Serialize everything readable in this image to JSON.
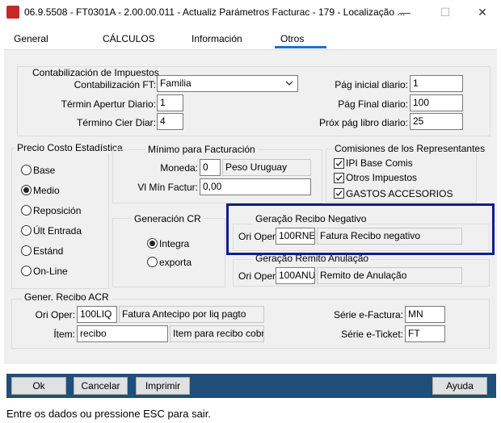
{
  "window": {
    "title": "06.9.5508 - FT0301A - 2.00.00.011 - Actualiz Parámetros Facturac - 179 - Localização ...",
    "min": "—",
    "max": "☐",
    "close": "✕"
  },
  "tabs": [
    "General",
    "CÁLCULOS",
    "Información",
    "Otros"
  ],
  "contab": {
    "title": "Contabilización de Impuestos",
    "ft_label": "Contabilización FT:",
    "ft_value": "Familia",
    "apertura_label": "Términ Apertur Diario:",
    "apertura_value": "1",
    "cierre_label": "Término Cier Diar:",
    "cierre_value": "4",
    "pag_inicial_label": "Pág inicial diario:",
    "pag_inicial_value": "1",
    "pag_final_label": "Pág Final diario:",
    "pag_final_value": "100",
    "prox_label": "Próx pág libro diario:",
    "prox_value": "25"
  },
  "precio": {
    "title": "Precio Costo Estadística",
    "options": [
      "Base",
      "Medio",
      "Reposición",
      "Últ Entrada",
      "Estánd",
      "On-Line"
    ],
    "selected": "Medio"
  },
  "minimo": {
    "title": "Mínimo para Facturación",
    "moneda_label": "Moneda:",
    "moneda_code": "0",
    "moneda_name": "Peso Uruguay",
    "vl_label": "Vl Mín Factur:",
    "vl_value": "0,00"
  },
  "comisiones": {
    "title": "Comisiones de los Representantes",
    "items": [
      "IPI Base Comis",
      "Otros Impuestos",
      "GASTOS ACCESORIOS"
    ]
  },
  "generacion": {
    "title": "Generación CR",
    "options": [
      "Integra",
      "exporta"
    ],
    "selected": "Integra"
  },
  "recibo_neg": {
    "title": "Geração Recibo Negativo",
    "oper_label": "Ori Oper:",
    "oper_code": "100RNE",
    "oper_desc": "Fatura Recibo negativo"
  },
  "remito": {
    "title": "Geração Remito Anulação",
    "oper_label": "Ori Oper:",
    "oper_code": "100ANU",
    "oper_desc": "Remito de Anulação"
  },
  "gener": {
    "title": "Gener. Recibo ACR",
    "oper_label": "Ori Oper:",
    "oper_code": "100LIQ",
    "oper_desc": "Fatura Antecipo por liq pagto",
    "item_label": "Ítem:",
    "item_code": "recibo",
    "item_desc": "Item para recibo cobranza",
    "efactura_label": "Série e-Factura:",
    "efactura_value": "MN",
    "eticket_label": "Série e-Ticket:",
    "eticket_value": "FT"
  },
  "buttons": {
    "ok": "Ok",
    "cancel": "Cancelar",
    "print": "Imprimir",
    "help": "Ayuda"
  },
  "status": "Entre os dados ou pressione ESC para sair.",
  "colors": {
    "button_bar": "#1f4e79",
    "highlight": "#0d1e8c",
    "tab_accent": "#1e70c8"
  }
}
